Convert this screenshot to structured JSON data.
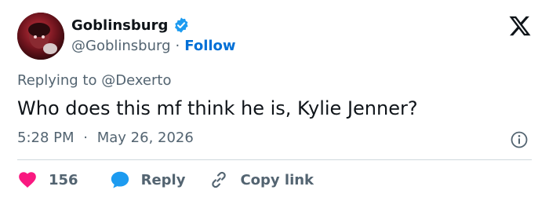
{
  "user": {
    "display_name": "Goblinsburg",
    "handle": "@Goblinsburg",
    "follow_label": "Follow",
    "separator": "·"
  },
  "tweet": {
    "replying_to_prefix": "Replying to",
    "replying_to_handle": "@Dexerto",
    "text": "Who does this mf think he is, Kylie Jenner?",
    "time": "5:28 PM",
    "date": "May 26, 2026",
    "separator": "·"
  },
  "actions": {
    "like_count": "156",
    "reply_label": "Reply",
    "copy_link_label": "Copy link"
  },
  "colors": {
    "like": "#f91880",
    "reply": "#1d9bf0",
    "follow": "#006fd6",
    "verified": "#1d9bf0",
    "muted": "#536471"
  },
  "icons": {
    "verified": "verified-badge-icon",
    "logo": "x-logo-icon",
    "info": "info-icon",
    "like": "heart-icon",
    "reply": "speech-bubble-icon",
    "copy_link": "link-icon"
  }
}
